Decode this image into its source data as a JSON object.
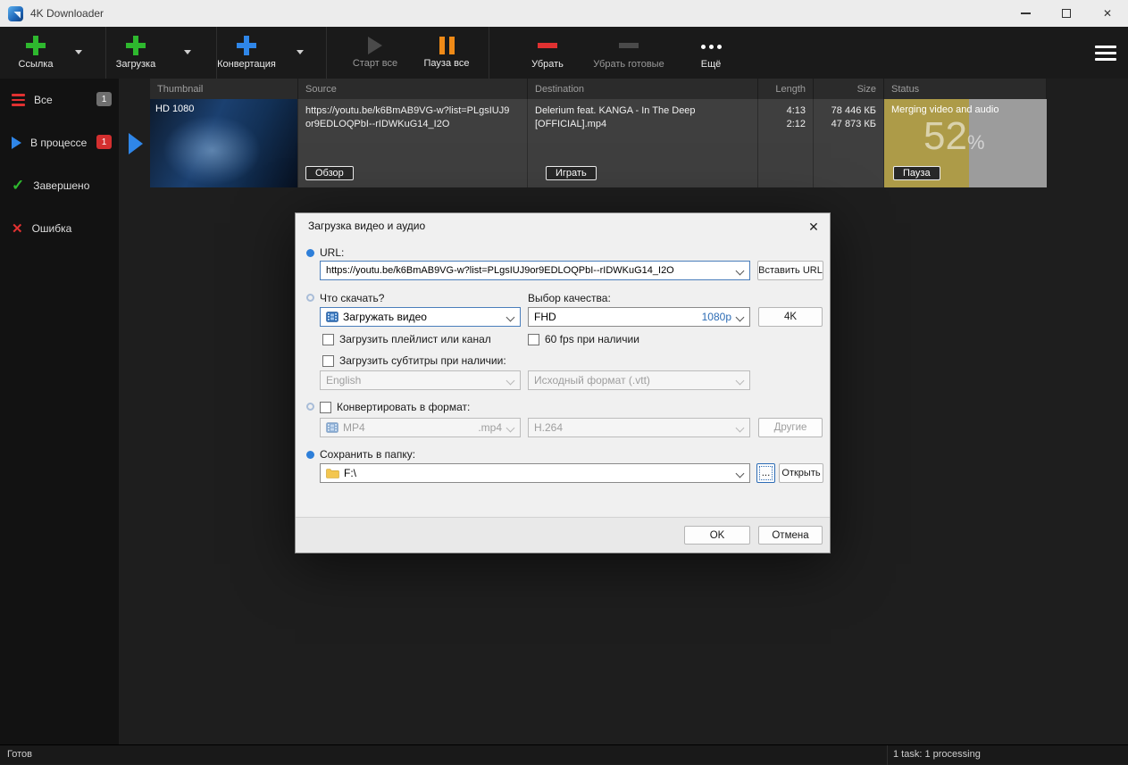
{
  "titlebar": {
    "title": "4K Downloader"
  },
  "toolbar": {
    "buttons": [
      {
        "label": "Ссылка"
      },
      {
        "label": "Загрузка"
      },
      {
        "label": "Конвертация"
      },
      {
        "label": "Старт все"
      },
      {
        "label": "Пауза все"
      },
      {
        "label": "Убрать"
      },
      {
        "label": "Убрать готовые"
      },
      {
        "label": "Ещё"
      }
    ],
    "accent_green": "#2eb82e",
    "accent_blue": "#2f86e8",
    "accent_orange": "#ef8a17",
    "accent_red": "#e03131",
    "disabled_gray": "#4a4a4a"
  },
  "sidebar": {
    "items": [
      {
        "label": "Все",
        "badge": "1"
      },
      {
        "label": "В процессе",
        "badge": "1"
      },
      {
        "label": "Завершено"
      },
      {
        "label": "Ошибка"
      }
    ]
  },
  "table": {
    "columns": [
      "Thumbnail",
      "Source",
      "Destination",
      "Length",
      "Size",
      "Status"
    ],
    "row": {
      "thumb_quality": "HD 1080",
      "source_url": "https://youtu.be/k6BmAB9VG-w?list=PLgsIUJ9or9EDLOQPbI--rIDWKuG14_I2O",
      "browse_button": "Обзор",
      "destination": "Delerium feat. KANGA - In The Deep [OFFICIAL].mp4",
      "play_button": "Играть",
      "length_total": "4:13",
      "length_done": "2:12",
      "size_total": "78 446 КБ",
      "size_done": "47 873 КБ",
      "status_text": "Merging video and audio",
      "progress": 52,
      "percent_sign": "%",
      "pause_button": "Пауза"
    }
  },
  "dialog": {
    "title": "Загрузка видео и аудио",
    "url_label": "URL:",
    "url_value": "https://youtu.be/k6BmAB9VG-w?list=PLgsIUJ9or9EDLOQPbI--rIDWKuG14_I2O",
    "paste_url_button": "Вставить URL",
    "what_label": "Что скачать?",
    "quality_label": "Выбор качества:",
    "mode_value": "Загружать видео",
    "quality_value": "FHD",
    "quality_resolution": "1080p",
    "fourk_button": "4K",
    "playlist_checkbox": "Загрузить плейлист или канал",
    "fps_checkbox": "60 fps при наличии",
    "subtitles_checkbox": "Загрузить субтитры при наличии:",
    "subtitle_language": "English",
    "subtitle_format": "Исходный формат (.vtt)",
    "convert_checkbox": "Конвертировать в формат:",
    "convert_format": "MP4",
    "convert_ext": ".mp4",
    "convert_codec": "H.264",
    "others_button": "Другие",
    "save_label": "Сохранить в папку:",
    "save_path": "F:\\",
    "browse_dots_button": "...",
    "open_button": "Открыть",
    "ok_button": "OK",
    "cancel_button": "Отмена"
  },
  "statusbar": {
    "left": "Готов",
    "right": "1 task: 1 processing"
  }
}
